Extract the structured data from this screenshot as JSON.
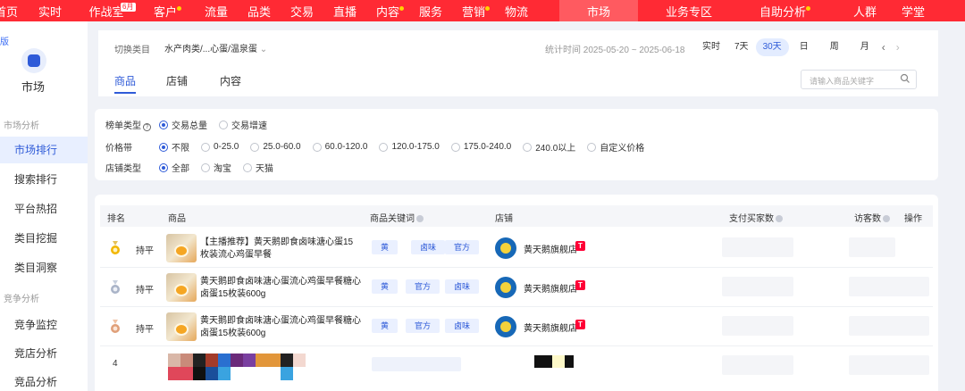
{
  "topnav": {
    "items": [
      {
        "label": "首页"
      },
      {
        "label": "实时"
      },
      {
        "label": "作战室"
      },
      {
        "label": "客户"
      },
      {
        "label": "流量"
      },
      {
        "label": "品类"
      },
      {
        "label": "交易"
      },
      {
        "label": "直播"
      },
      {
        "label": "内容"
      },
      {
        "label": "服务"
      },
      {
        "label": "营销"
      },
      {
        "label": "物流"
      },
      {
        "label": "市场"
      },
      {
        "label": "业务专区"
      },
      {
        "label": "自助分析"
      },
      {
        "label": "人群"
      },
      {
        "label": "学堂"
      }
    ],
    "badge": "6月",
    "active": "市场"
  },
  "sidebar": {
    "edge_text": "版",
    "title": "市场",
    "sections": [
      {
        "title": "市场分析",
        "items": [
          "市场排行",
          "搜索排行",
          "平台热招",
          "类目挖掘",
          "类目洞察"
        ]
      },
      {
        "title": "竞争分析",
        "items": [
          "竞争监控",
          "竞店分析",
          "竞品分析"
        ]
      }
    ],
    "active_item": "市场排行"
  },
  "filterbar": {
    "category_label": "切换类目",
    "category_value": "水产肉类/...心蛋/温泉蛋",
    "stat_time": "统计时间 2025-05-20 ~ 2025-06-18",
    "periods": [
      "实时",
      "7天",
      "30天",
      "日",
      "周",
      "月"
    ],
    "active_period": "30天"
  },
  "tabs": {
    "items": [
      "商品",
      "店铺",
      "内容"
    ],
    "active": "商品",
    "search_placeholder": "请输入商品关键字"
  },
  "filters": {
    "rank_type": {
      "label": "榜单类型",
      "options": [
        "交易总量",
        "交易增速"
      ],
      "selected": "交易总量"
    },
    "price": {
      "label": "价格带",
      "options": [
        "不限",
        "0-25.0",
        "25.0-60.0",
        "60.0-120.0",
        "120.0-175.0",
        "175.0-240.0",
        "240.0以上",
        "自定义价格"
      ],
      "selected": "不限"
    },
    "shop_type": {
      "label": "店铺类型",
      "options": [
        "全部",
        "淘宝",
        "天猫"
      ],
      "selected": "全部"
    }
  },
  "table": {
    "headers": {
      "rank": "排名",
      "product": "商品",
      "keywords": "商品关键词",
      "shop": "店铺",
      "buyers": "支付买家数",
      "visitors": "访客数",
      "action": "操作"
    },
    "rows": [
      {
        "medal": "gold",
        "trend": "持平",
        "name": "【主播推荐】黄天鹅即食卤味溏心蛋15枚装流心鸡蛋早餐",
        "keywords": [
          "黄",
          "卤味",
          "官方"
        ],
        "shop": "黄天鹅旗舰店"
      },
      {
        "medal": "silver",
        "trend": "持平",
        "name": "黄天鹅即食卤味溏心蛋流心鸡蛋早餐糖心卤蛋15枚装600g",
        "keywords": [
          "黄",
          "官方",
          "卤味"
        ],
        "shop": "黄天鹅旗舰店"
      },
      {
        "medal": "bronze",
        "trend": "持平",
        "name": "黄天鹅即食卤味溏心蛋流心鸡蛋早餐糖心卤蛋15枚装600g",
        "keywords": [
          "黄",
          "官方",
          "卤味"
        ],
        "shop": "黄天鹅旗舰店"
      }
    ],
    "row4_rank": "4"
  },
  "colors": {
    "nav_red": "#ff2a34",
    "accent_blue": "#2f5bd8",
    "gold": "#f2b705",
    "silver": "#aab4c8",
    "bronze": "#e0a07a"
  }
}
